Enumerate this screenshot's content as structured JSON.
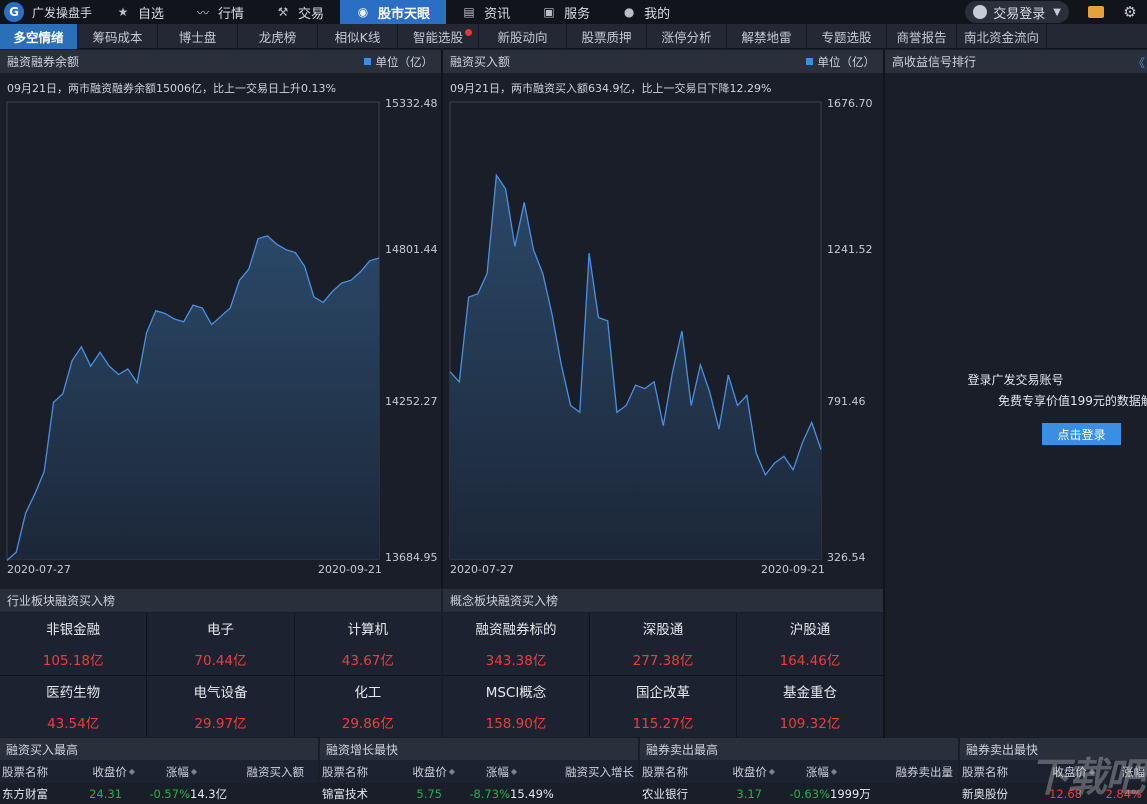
{
  "app": {
    "name": "广发操盘手"
  },
  "nav": {
    "items": [
      {
        "label": "自选",
        "icon": "star-icon"
      },
      {
        "label": "行情",
        "icon": "chart-icon"
      },
      {
        "label": "交易",
        "icon": "hammer-icon"
      },
      {
        "label": "股市天眼",
        "icon": "eye-icon"
      },
      {
        "label": "资讯",
        "icon": "news-icon"
      },
      {
        "label": "服务",
        "icon": "briefcase-icon"
      },
      {
        "label": "我的",
        "icon": "user-icon"
      }
    ],
    "login": "交易登录"
  },
  "subtabs": [
    "多空情绪",
    "筹码成本",
    "博士盘",
    "龙虎榜",
    "相似K线",
    "智能选股",
    "新股动向",
    "股票质押",
    "涨停分析",
    "解禁地雷",
    "专题选股",
    "商誉报告",
    "南北资金流向"
  ],
  "chart_data": [
    {
      "type": "area",
      "title": "融资融券余额",
      "unit": "单位（亿）",
      "subtitle": "09月21日，两市融资融券余额15006亿，比上一交易日上升0.13%",
      "x_start": "2020-07-27",
      "x_end": "2020-09-21",
      "ylim": [
        13684.95,
        15332.48
      ],
      "yticks": [
        "15332.48",
        "14801.44",
        "14252.27",
        "13684.95"
      ],
      "values": [
        13680,
        13710,
        13850,
        13920,
        14000,
        14250,
        14280,
        14400,
        14450,
        14380,
        14430,
        14380,
        14350,
        14370,
        14320,
        14500,
        14580,
        14570,
        14550,
        14540,
        14600,
        14590,
        14530,
        14560,
        14590,
        14690,
        14730,
        14840,
        14850,
        14820,
        14800,
        14790,
        14740,
        14630,
        14610,
        14650,
        14680,
        14690,
        14720,
        14760,
        14770
      ]
    },
    {
      "type": "area",
      "title": "融资买入额",
      "unit": "单位（亿）",
      "subtitle": "09月21日，两市融资买入额634.9亿，比上一交易日下降12.29%",
      "x_start": "2020-07-27",
      "x_end": "2020-09-21",
      "ylim": [
        326.54,
        1676.7
      ],
      "yticks": [
        "1676.70",
        "1241.52",
        "791.46",
        "326.54"
      ],
      "values": [
        880,
        850,
        1100,
        1110,
        1170,
        1460,
        1420,
        1250,
        1380,
        1240,
        1170,
        1050,
        900,
        780,
        760,
        1230,
        1040,
        1030,
        760,
        780,
        840,
        830,
        850,
        720,
        880,
        1000,
        780,
        900,
        820,
        710,
        870,
        780,
        810,
        640,
        575,
        610,
        630,
        590,
        670,
        730,
        650
      ]
    }
  ],
  "panels": {
    "right_title": "高收益信号排行",
    "right_collapse": "《",
    "right_msg1": "登录广发交易账号",
    "right_msg2": "免费专享价值199元的数据解",
    "right_cta": "点击登录",
    "industry_title": "行业板块融资买入榜",
    "concept_title": "概念板块融资买入榜"
  },
  "industry": [
    {
      "name": "非银金融",
      "value": "105.18亿"
    },
    {
      "name": "电子",
      "value": "70.44亿"
    },
    {
      "name": "计算机",
      "value": "43.67亿"
    },
    {
      "name": "医药生物",
      "value": "43.54亿"
    },
    {
      "name": "电气设备",
      "value": "29.97亿"
    },
    {
      "name": "化工",
      "value": "29.86亿"
    }
  ],
  "concept": [
    {
      "name": "融资融券标的",
      "value": "343.38亿"
    },
    {
      "name": "深股通",
      "value": "277.38亿"
    },
    {
      "name": "沪股通",
      "value": "164.46亿"
    },
    {
      "name": "MSCI概念",
      "value": "158.90亿"
    },
    {
      "name": "国企改革",
      "value": "115.27亿"
    },
    {
      "name": "基金重仓",
      "value": "109.32亿"
    }
  ],
  "tables": [
    {
      "title": "融资买入最高",
      "cols": [
        "股票名称",
        "收盘价",
        "涨幅",
        "融资买入额"
      ],
      "row": [
        "东方财富",
        "24.31",
        "-0.57%",
        "14.3亿"
      ]
    },
    {
      "title": "融资增长最快",
      "cols": [
        "股票名称",
        "收盘价",
        "涨幅",
        "融资买入增长"
      ],
      "row": [
        "锦富技术",
        "5.75",
        "-8.73%",
        "15.49%"
      ]
    },
    {
      "title": "融券卖出最高",
      "cols": [
        "股票名称",
        "收盘价",
        "涨幅",
        "融券卖出量"
      ],
      "row": [
        "农业银行",
        "3.17",
        "-0.63%",
        "1999万"
      ]
    },
    {
      "title": "融券卖出最快",
      "cols": [
        "股票名称",
        "收盘价",
        "涨幅"
      ],
      "row": [
        "新奥股份",
        "12.68",
        "2.84%"
      ]
    }
  ],
  "watermark": "下载吧"
}
